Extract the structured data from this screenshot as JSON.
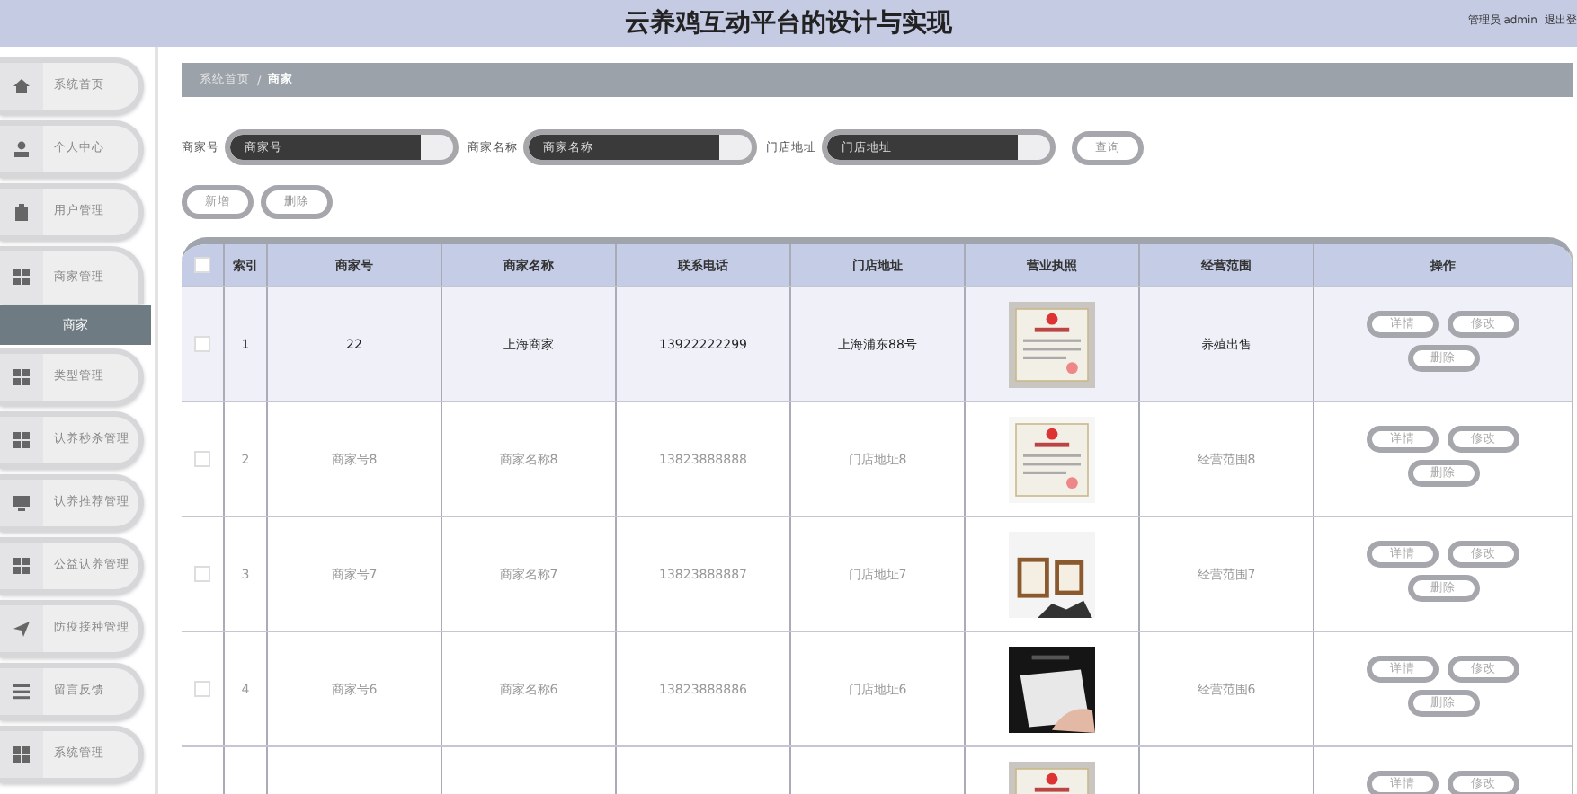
{
  "header": {
    "title": "云养鸡互动平台的设计与实现",
    "user": "管理员 admin",
    "logout": "退出登"
  },
  "sidebar": {
    "items": [
      {
        "label": "系统首页",
        "selected": false
      },
      {
        "label": "个人中心",
        "selected": false
      },
      {
        "label": "用户管理",
        "selected": false
      },
      {
        "label": "商家管理",
        "selected": false,
        "expanded": true,
        "children": [
          {
            "label": "商家",
            "selected": true
          }
        ]
      },
      {
        "label": "类型管理",
        "selected": false
      },
      {
        "label": "认养秒杀管理",
        "selected": false
      },
      {
        "label": "认养推荐管理",
        "selected": false
      },
      {
        "label": "公益认养管理",
        "selected": false
      },
      {
        "label": "防疫接种管理",
        "selected": false
      },
      {
        "label": "留言反馈",
        "selected": false
      },
      {
        "label": "系统管理",
        "selected": false
      }
    ]
  },
  "breadcrumb": [
    "系统首页",
    "/",
    "商家"
  ],
  "search": {
    "fields": [
      {
        "label": "商家号",
        "placeholder": "商家号"
      },
      {
        "label": "商家名称",
        "placeholder": "商家名称"
      },
      {
        "label": "门店地址",
        "placeholder": "门店地址"
      }
    ],
    "button": "查询"
  },
  "actions": [
    "新增",
    "删除"
  ],
  "table": {
    "columns": [
      "索引",
      "商家号",
      "商家名称",
      "联系电话",
      "门店地址",
      "营业执照",
      "经营范围",
      "操作"
    ],
    "header_checked": false,
    "rows": [
      {
        "checked": false,
        "highlighted": true,
        "cells": [
          "1",
          "22",
          "上海商家",
          "13922222299",
          "上海浦东88号"
        ],
        "scope": "养殖出售",
        "buttons": [
          "详情",
          "修改",
          "删除"
        ]
      },
      {
        "checked": false,
        "highlighted": false,
        "cells": [
          "2",
          "商家号8",
          "商家名称8",
          "13823888888",
          "门店地址8"
        ],
        "scope": "经营范围8",
        "buttons": [
          "详情",
          "修改",
          "删除"
        ]
      },
      {
        "checked": false,
        "highlighted": false,
        "cells": [
          "3",
          "商家号7",
          "商家名称7",
          "13823888887",
          "门店地址7"
        ],
        "scope": "经营范围7",
        "buttons": [
          "详情",
          "修改",
          "删除"
        ]
      },
      {
        "checked": false,
        "highlighted": false,
        "cells": [
          "4",
          "商家号6",
          "商家名称6",
          "13823888886",
          "门店地址6"
        ],
        "scope": "经营范围6",
        "buttons": [
          "详情",
          "修改",
          "删除"
        ]
      },
      {
        "highlighted": false,
        "buttons": [
          "详情",
          "修改"
        ]
      }
    ]
  }
}
